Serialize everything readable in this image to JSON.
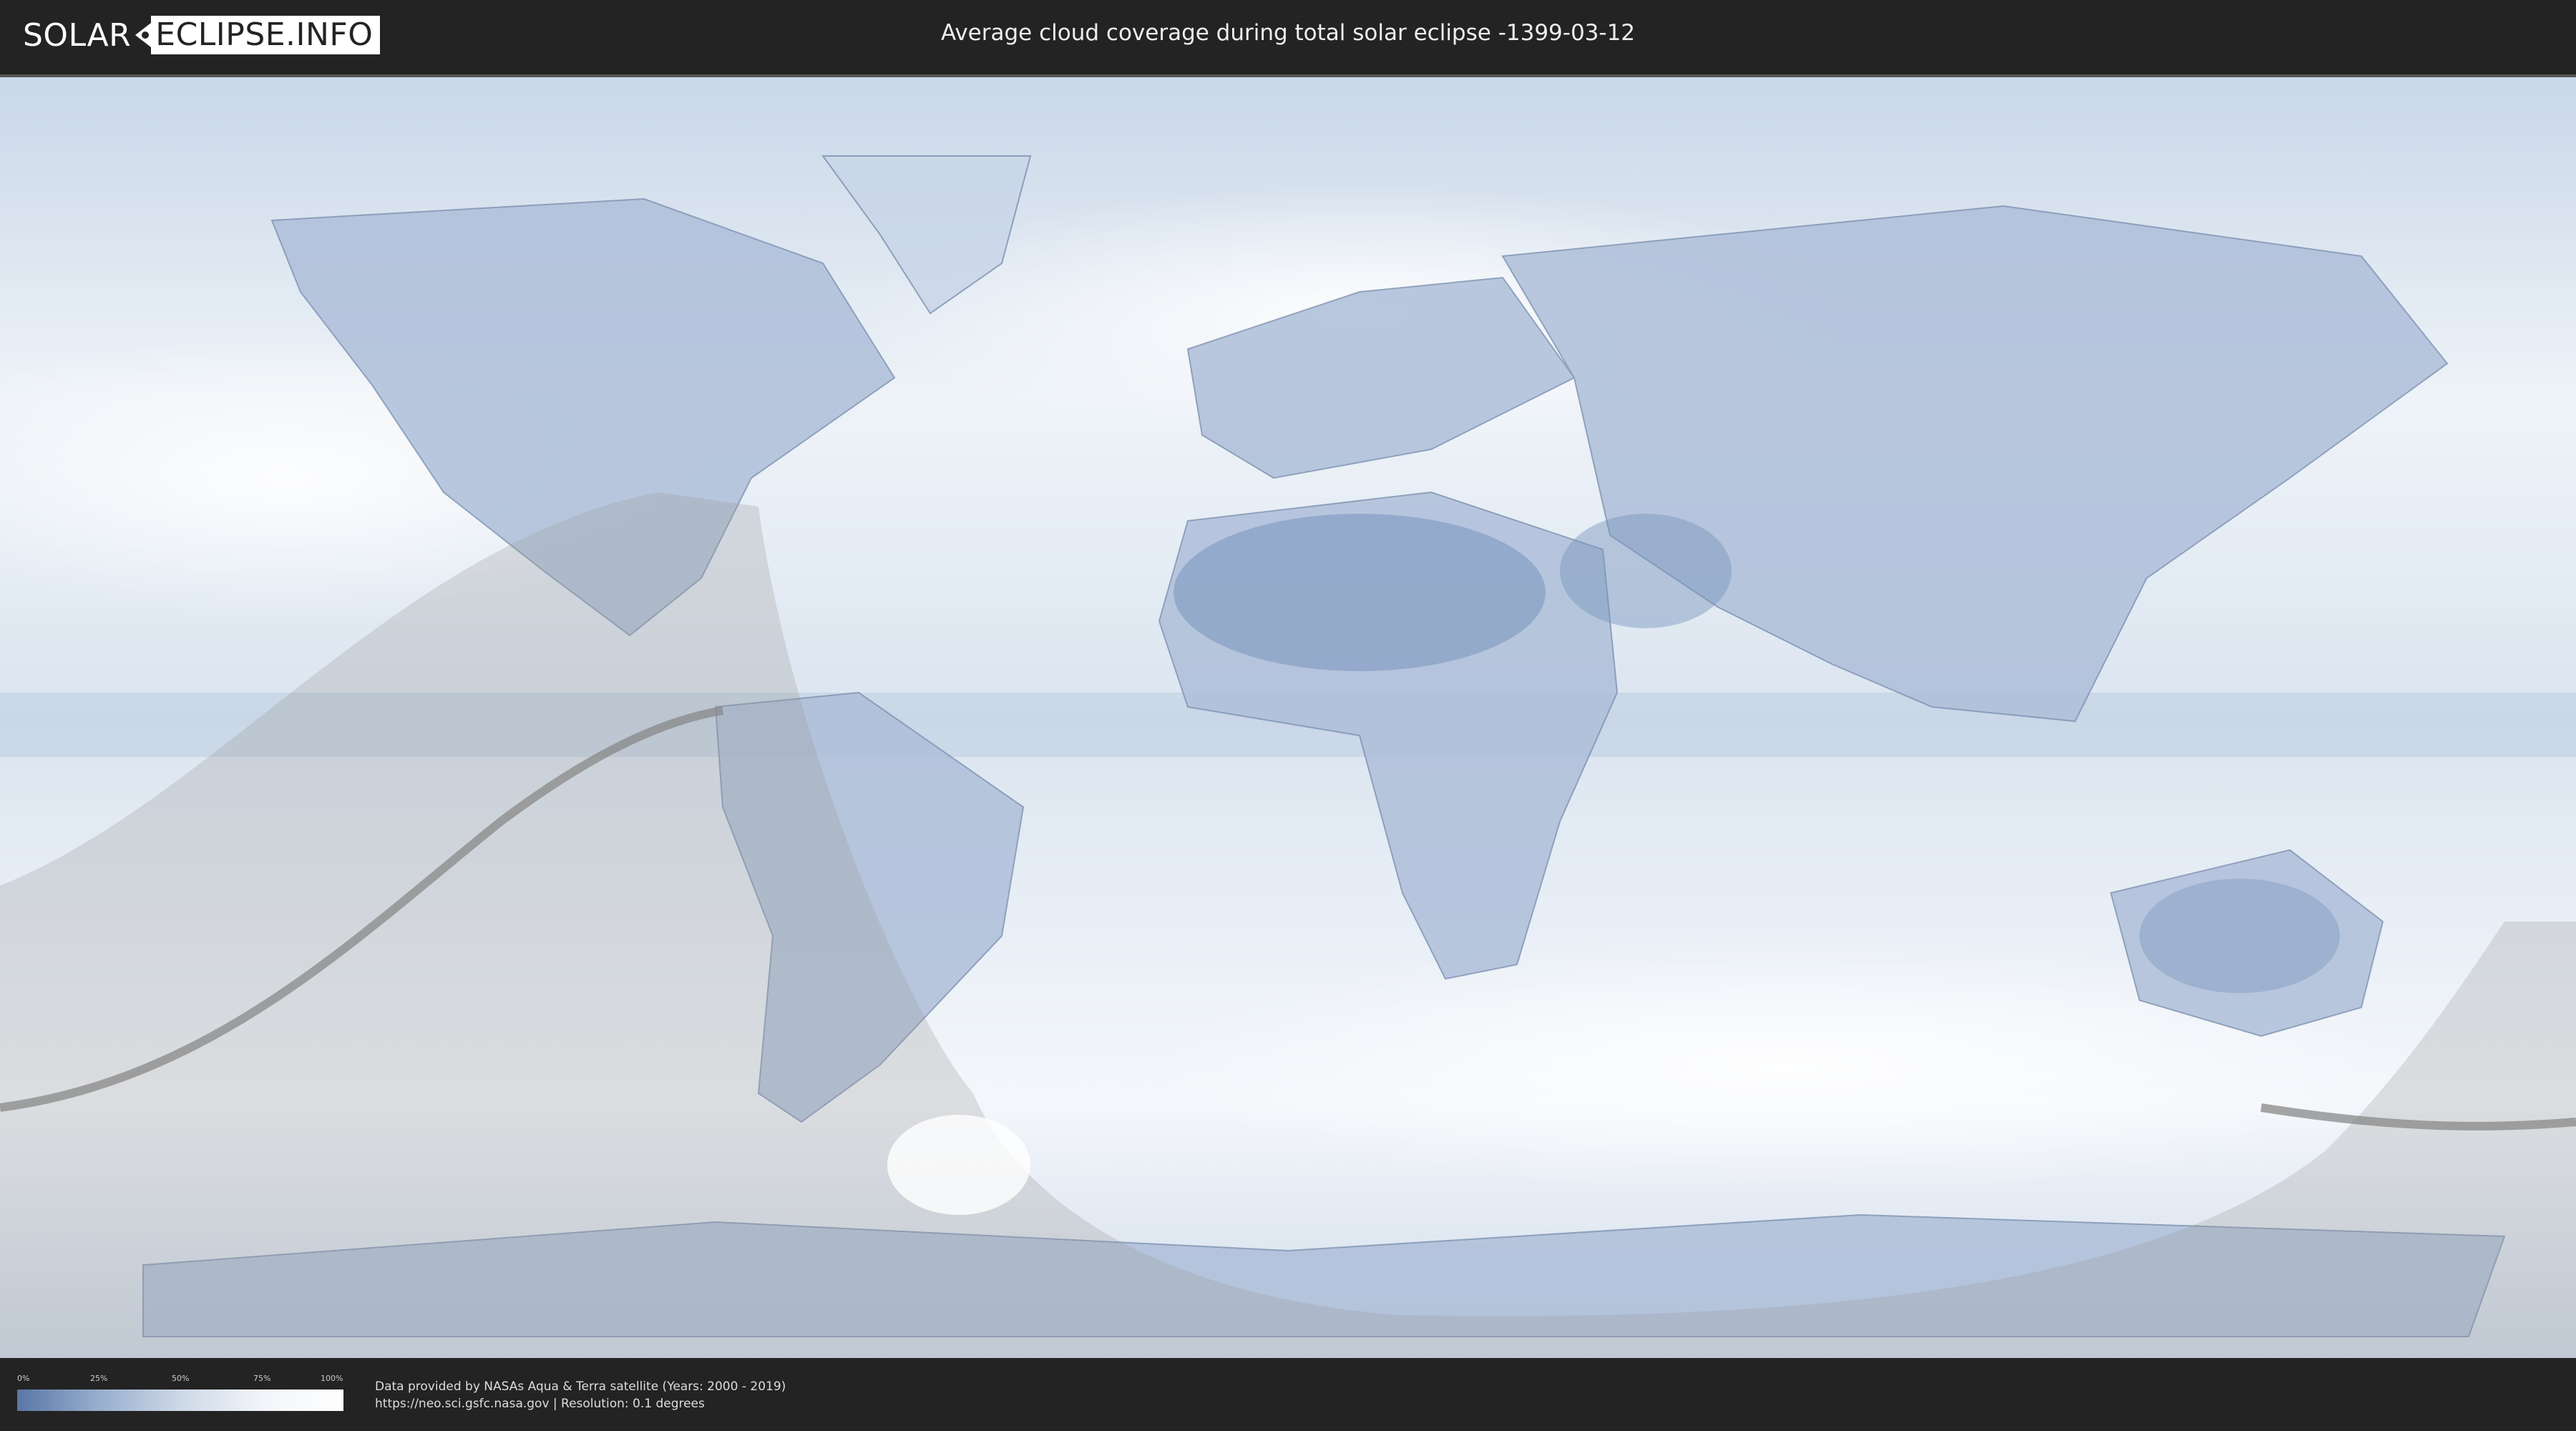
{
  "header": {
    "logo_left": "SOLAR",
    "logo_right": "ECLIPSE.INFO",
    "title": "Average cloud coverage during total solar eclipse -1399-03-12"
  },
  "legend": {
    "ticks": [
      "0%",
      "25%",
      "50%",
      "75%",
      "100%"
    ],
    "colors": [
      "#5a76a8",
      "#98aecd",
      "#cdd8e7",
      "#f2f5f9",
      "#ffffff"
    ]
  },
  "footer": {
    "credit_line1": "Data provided by NASAs Aqua & Terra satellite (Years: 2000 - 2019)",
    "credit_line2": "https://neo.sci.gsfc.nasa.gov | Resolution: 0.1 degrees"
  },
  "map": {
    "background": "#dfe8f2",
    "land_color": "#8ea6cc",
    "eclipse_shade": "#9a9a9a"
  }
}
